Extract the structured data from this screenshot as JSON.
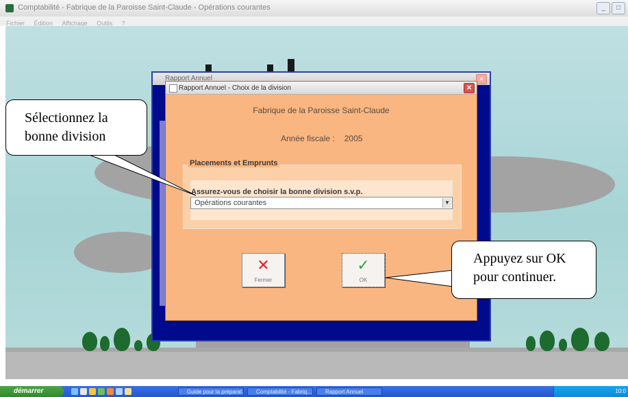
{
  "app": {
    "title": "Comptabilité - Fabrique de la Paroisse Saint-Claude - Opérations courantes",
    "menu": [
      "Fichier",
      "Édition",
      "Affichage",
      "Outils",
      "?"
    ]
  },
  "back_dialog": {
    "title": "Rapport Annuel",
    "close_label": "✕"
  },
  "dialog": {
    "title": "Rapport Annuel - Choix de la division",
    "close_label": "✕",
    "organization": "Fabrique de la Paroisse Saint-Claude",
    "fiscal_label": "Année fiscale :",
    "fiscal_year": "2005",
    "group_title": "Placements et Emprunts",
    "prompt": "Assurez-vous de choisir la bonne division s.v.p.",
    "division_value": "Opérations courantes",
    "close_button_label": "Fermer",
    "ok_button_label": "OK"
  },
  "callouts": {
    "left_line1": "Sélectionnez la",
    "left_line2": "bonne division",
    "right_line1": "Appuyez sur OK",
    "right_line2": "pour continuer."
  },
  "taskbar": {
    "start_label": "démarrer",
    "tasks": [
      "Guide pour la préparat...",
      "Comptabilité - Fabriq...",
      "Rapport Annuel"
    ],
    "time": "10:0"
  },
  "colors": {
    "dialog_bg": "#f9b681",
    "navy_frame": "#000a8c",
    "close_x": "#e21f26",
    "ok_check": "#2ea043"
  },
  "icons": {
    "close_button_icon": "x-icon",
    "ok_button_icon": "checkmark-icon"
  }
}
